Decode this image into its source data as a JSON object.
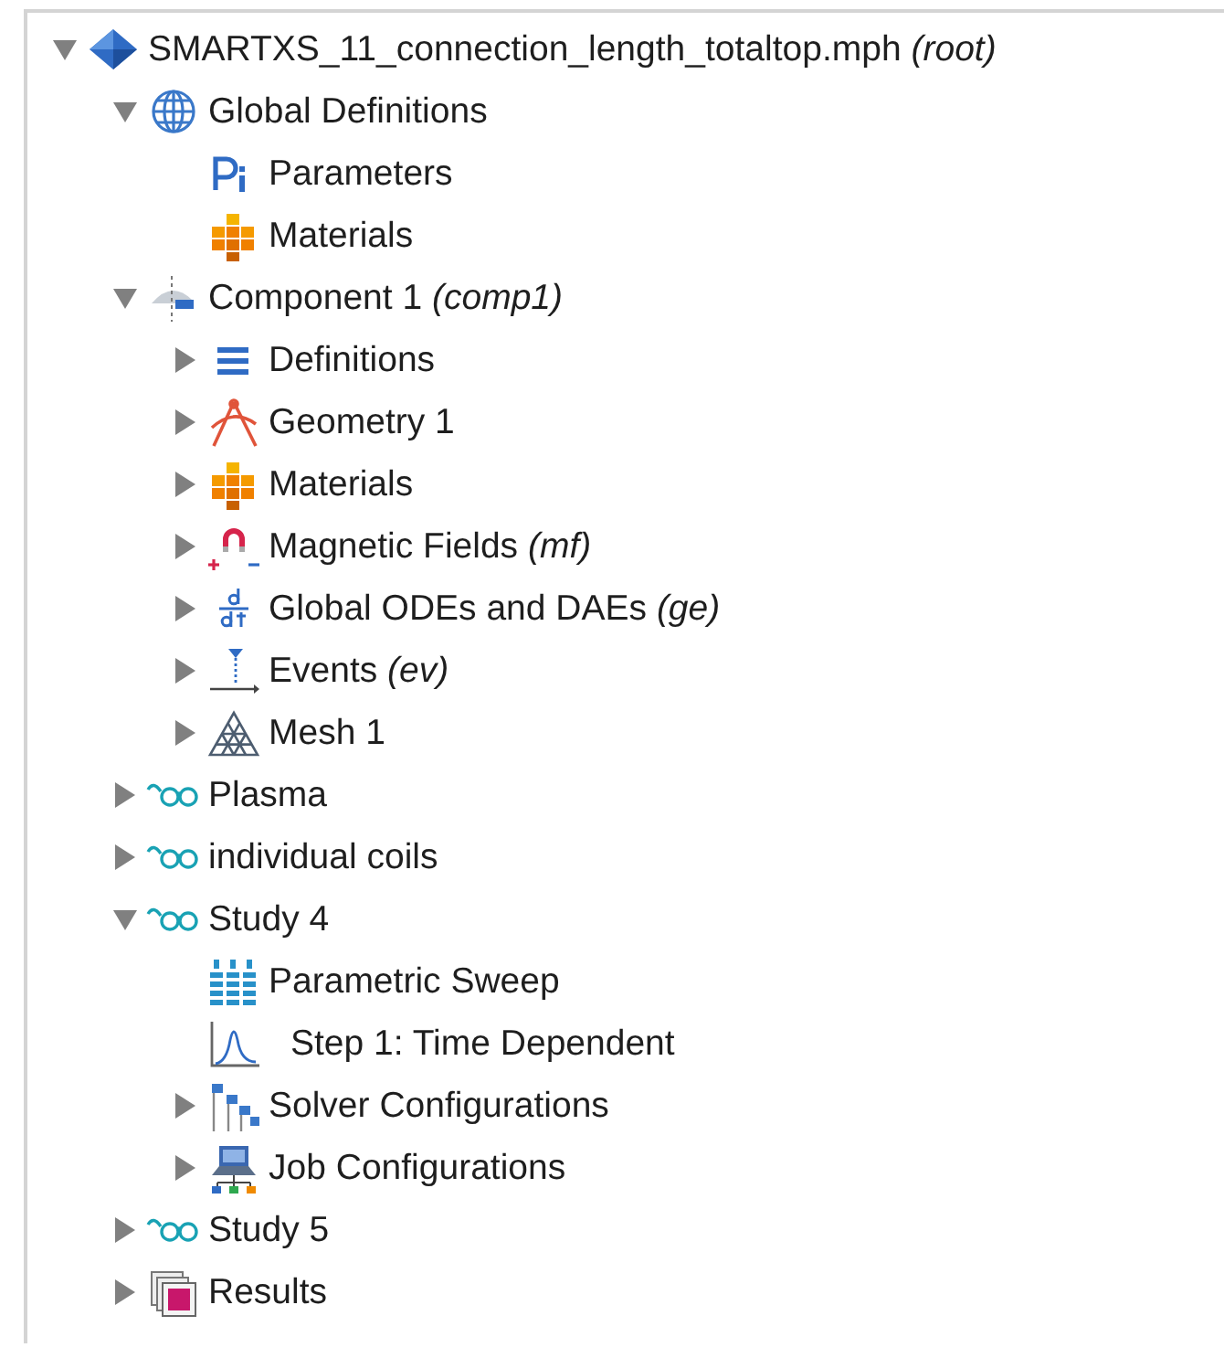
{
  "tree": [
    {
      "label": "SMARTXS_11_connection_length_totaltop.mph",
      "note": "(root)",
      "kind": "model",
      "expanded": true,
      "children": [
        {
          "label": "Global Definitions",
          "kind": "globe",
          "expanded": true,
          "children": [
            {
              "label": "Parameters",
              "kind": "parameters"
            },
            {
              "label": "Materials",
              "kind": "materials"
            }
          ]
        },
        {
          "label": "Component 1",
          "note": "(comp1)",
          "kind": "component",
          "expanded": true,
          "children": [
            {
              "label": "Definitions",
              "kind": "definitions",
              "expanded": false
            },
            {
              "label": "Geometry 1",
              "kind": "geometry",
              "expanded": false
            },
            {
              "label": "Materials",
              "kind": "materials",
              "expanded": false
            },
            {
              "label": "Magnetic Fields",
              "note": "(mf)",
              "kind": "magnet",
              "expanded": false
            },
            {
              "label": "Global ODEs and DAEs",
              "note": "(ge)",
              "kind": "ddt",
              "expanded": false
            },
            {
              "label": "Events",
              "note": "(ev)",
              "kind": "events",
              "expanded": false
            },
            {
              "label": "Mesh 1",
              "kind": "mesh",
              "expanded": false
            }
          ]
        },
        {
          "label": "Plasma",
          "kind": "study",
          "expanded": false
        },
        {
          "label": "individual coils",
          "kind": "study",
          "expanded": false
        },
        {
          "label": "Study 4",
          "kind": "study",
          "expanded": true,
          "children": [
            {
              "label": "Parametric Sweep",
              "kind": "sweep"
            },
            {
              "label": "Step 1: Time Dependent",
              "kind": "timedep"
            },
            {
              "label": "Solver Configurations",
              "kind": "solver",
              "expanded": false
            },
            {
              "label": "Job Configurations",
              "kind": "job",
              "expanded": false
            }
          ]
        },
        {
          "label": "Study 5",
          "kind": "study",
          "expanded": false
        },
        {
          "label": "Results",
          "kind": "results",
          "expanded": false
        }
      ]
    }
  ]
}
